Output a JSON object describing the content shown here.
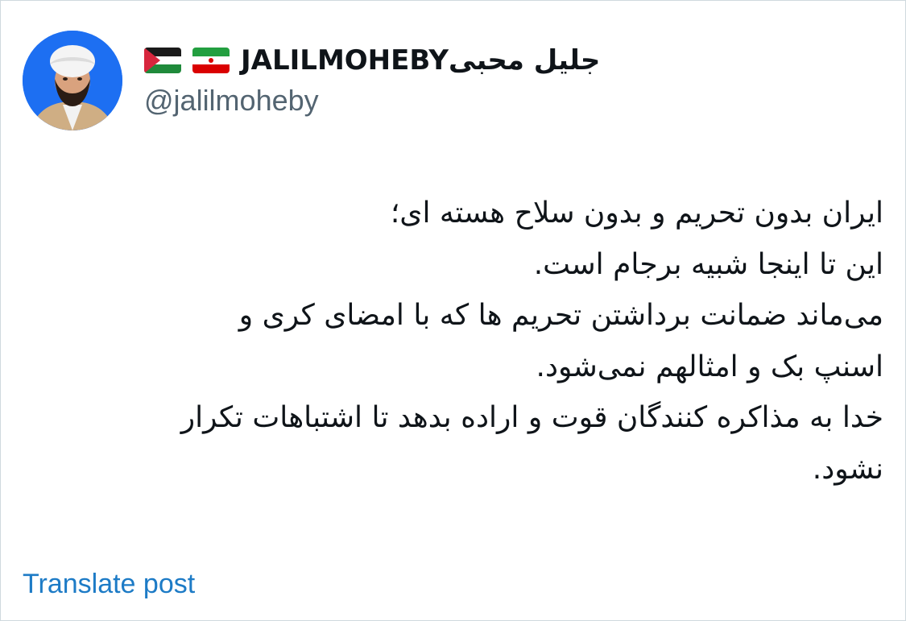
{
  "author": {
    "display_name": "جلیل محبیJALILMOHEBY",
    "handle": "@jalilmoheby",
    "avatar_icon": "profile-photo",
    "flags": [
      "iran-flag",
      "palestine-flag"
    ]
  },
  "post": {
    "lines": [
      "ایران بدون تحریم و بدون سلاح هسته ای؛",
      "این تا اینجا شبیه برجام است.",
      "می‌ماند ضمانت برداشتن تحریم ها که با امضای کری و",
      "اسنپ بک و امثالهم نمی‌شود.",
      "خدا به مذاکره کنندگان قوت و اراده بدهد تا اشتباهات تکرار",
      "نشود."
    ]
  },
  "actions": {
    "translate_label": "Translate post"
  },
  "colors": {
    "text": "#0f1419",
    "secondary": "#536471",
    "link": "#1d7bc6",
    "avatar_bg": "#1d6ff2",
    "border": "#cfd9de"
  }
}
